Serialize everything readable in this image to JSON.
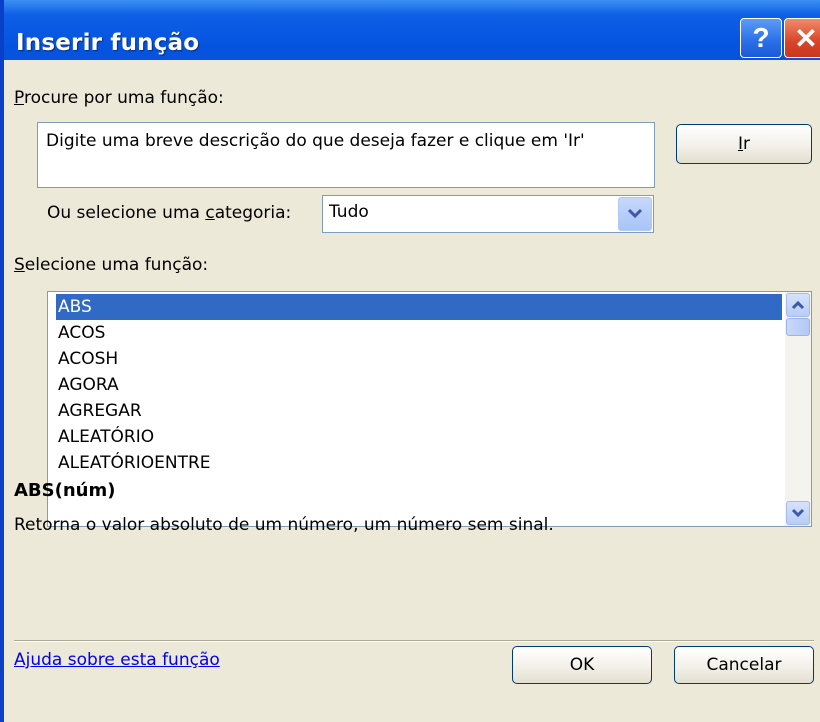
{
  "dialog": {
    "title": "Inserir função",
    "help_glyph": "?",
    "close_glyph": "✕"
  },
  "search": {
    "label_underlined": "P",
    "label_rest": "rocure por uma função:",
    "value": "Digite uma breve descrição do que deseja fazer e clique em 'Ir'",
    "go_underlined": "I",
    "go_rest": "r"
  },
  "category": {
    "label_before": "Ou selecione uma ",
    "label_underlined": "c",
    "label_after": "ategoria:",
    "selected": "Tudo"
  },
  "functions": {
    "label_underlined": "S",
    "label_rest": "elecione uma função:",
    "items": [
      "ABS",
      "ACOS",
      "ACOSH",
      "AGORA",
      "AGREGAR",
      "ALEATÓRIO",
      "ALEATÓRIOENTRE"
    ],
    "selected_index": 0
  },
  "details": {
    "signature": "ABS(núm)",
    "description": "Retorna o valor absoluto de um número, um número sem sinal."
  },
  "footer": {
    "help_link": "Ajuda sobre esta função",
    "ok_label": "OK",
    "cancel_label": "Cancelar"
  },
  "colors": {
    "titlebar": "#0454e0",
    "selection": "#316ac5",
    "dialog_bg": "#ece9d8",
    "link": "#0000ee"
  }
}
